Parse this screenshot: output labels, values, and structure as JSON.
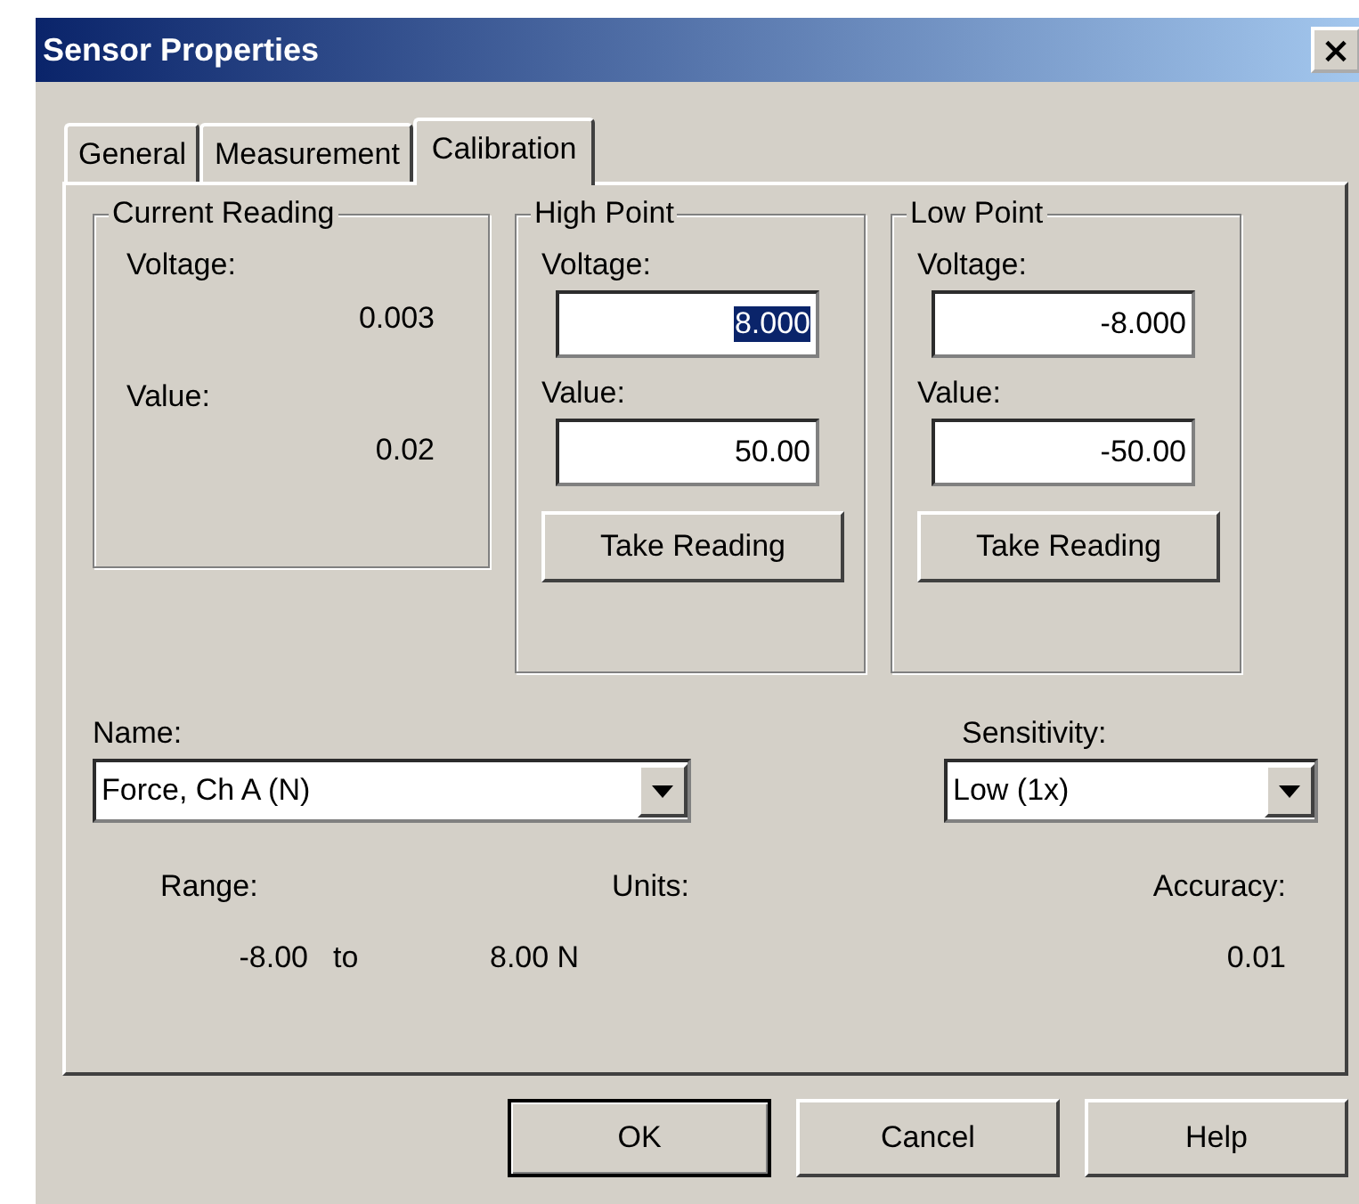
{
  "window": {
    "title": "Sensor Properties",
    "close": "×"
  },
  "tabs": [
    {
      "label": "General",
      "selected": false
    },
    {
      "label": "Measurement",
      "selected": false
    },
    {
      "label": "Calibration",
      "selected": true
    }
  ],
  "current_reading": {
    "title": "Current Reading",
    "voltage_label": "Voltage:",
    "voltage": "0.003",
    "value_label": "Value:",
    "value": "0.02"
  },
  "points": [
    {
      "title": "High Point",
      "voltage_label": "Voltage:",
      "voltage": "8.000",
      "voltage_selected": true,
      "value_label": "Value:",
      "value": "50.00",
      "button": "Take Reading"
    },
    {
      "title": "Low Point",
      "voltage_label": "Voltage:",
      "voltage": "-8.000",
      "voltage_selected": false,
      "value_label": "Value:",
      "value": "-50.00",
      "button": "Take Reading"
    }
  ],
  "name": {
    "label": "Name:",
    "value": "Force, Ch A (N)"
  },
  "sensitivity": {
    "label": "Sensitivity:",
    "value": "Low (1x)"
  },
  "info": {
    "range_label": "Range:",
    "range_from": "-8.00",
    "range_to_word": "to",
    "units_label": "Units:",
    "range_to": "8.00 N",
    "accuracy_label": "Accuracy:",
    "accuracy": "0.01"
  },
  "buttons": [
    {
      "label": "OK",
      "default": true
    },
    {
      "label": "Cancel",
      "default": false
    },
    {
      "label": "Help",
      "default": false
    }
  ]
}
